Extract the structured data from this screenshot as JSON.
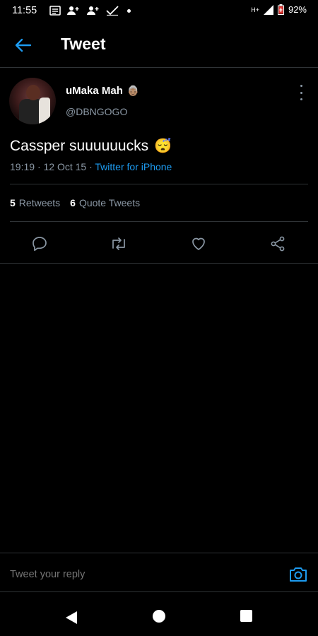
{
  "status_bar": {
    "time": "11:55",
    "network": "H+",
    "battery": "92%"
  },
  "header": {
    "title": "Tweet"
  },
  "tweet": {
    "author_name": "uMaka Mah",
    "author_emoji": "👵🏽",
    "handle": "@DBNGOGO",
    "text": "Cassper suuuuuucks",
    "text_emoji": "😴",
    "time": "19:19",
    "date": "12 Oct 15",
    "source": "Twitter for iPhone",
    "retweets_count": "5",
    "retweets_label": "Retweets",
    "quotes_count": "6",
    "quotes_label": "Quote Tweets"
  },
  "reply": {
    "placeholder": "Tweet your reply"
  },
  "colors": {
    "accent": "#1d9bf0",
    "muted": "#8b98a5",
    "divider": "#2f3336",
    "background": "#000000"
  },
  "icons": [
    "back-arrow-icon",
    "more-vertical-icon",
    "reply-icon",
    "retweet-icon",
    "like-icon",
    "share-icon",
    "camera-icon"
  ]
}
